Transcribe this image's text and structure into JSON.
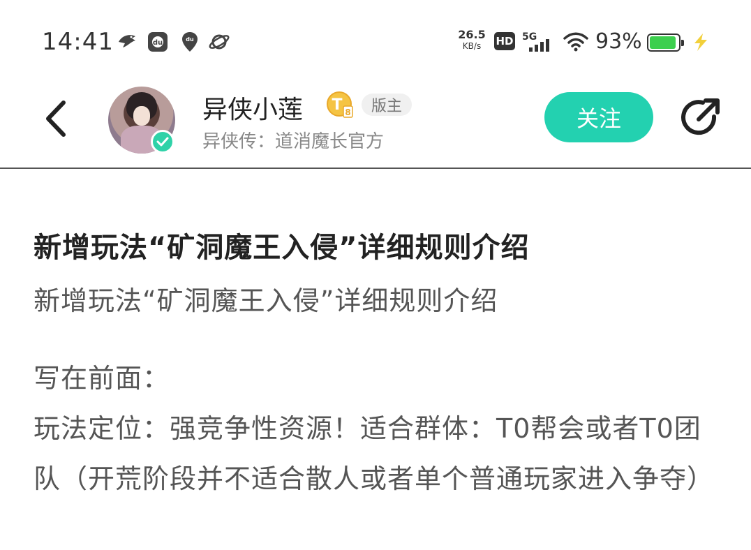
{
  "status_bar": {
    "time": "14:41",
    "net_speed_value": "26.5",
    "net_speed_unit": "KB/s",
    "hd": "HD",
    "signal": "5G",
    "battery": "93%",
    "battery_level": 0.93,
    "battery_color": "#3ccf4e",
    "icons": [
      "bird-icon",
      "du-app-icon",
      "location-du-icon",
      "planet-icon",
      "signal-bars-icon",
      "wifi-icon",
      "charging-bolt-icon"
    ]
  },
  "header": {
    "user_name": "异侠小莲",
    "level_badge": "T",
    "level_number": "8",
    "role_badge": "版主",
    "user_subtitle": "异侠传：道消魔长官方",
    "follow_label": "关注",
    "accent_color": "#23d1b0"
  },
  "post": {
    "title": "新增玩法“矿洞魔王入侵”详细规则介绍",
    "subtitle": "新增玩法“矿洞魔王入侵”详细规则介绍",
    "paragraphs": [
      "写在前面：",
      "玩法定位：强竞争性资源！适合群体：T0帮会或者T0团队（开荒阶段并不适合散人或者单个普通玩家进入争夺）"
    ]
  }
}
